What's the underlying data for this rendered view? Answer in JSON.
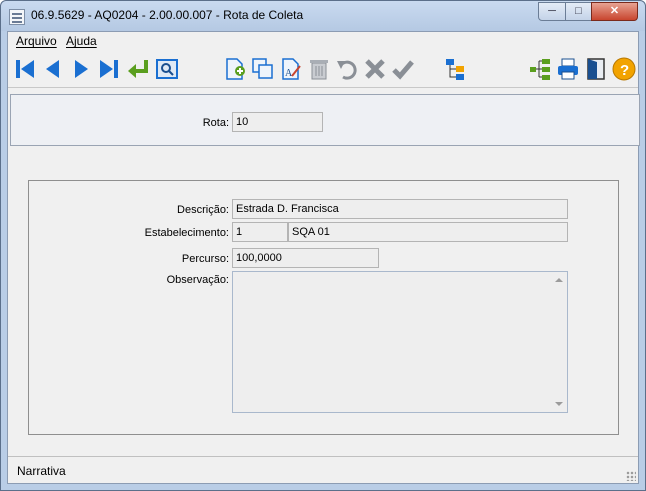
{
  "window": {
    "title": "06.9.5629 - AQ0204 - 2.00.00.007 - Rota de Coleta"
  },
  "menu": [
    {
      "label": "Arquivo"
    },
    {
      "label": "Ajuda"
    }
  ],
  "toolbar": {
    "icons": [
      "first-record-icon",
      "previous-record-icon",
      "next-record-icon",
      "last-record-icon",
      "goto-icon",
      "search-icon",
      "new-record-icon",
      "copy-record-icon",
      "edit-record-icon",
      "delete-record-icon",
      "undo-icon",
      "cancel-icon",
      "confirm-icon",
      "tree-structure-icon",
      "hierarchy-icon",
      "print-icon",
      "exit-icon",
      "help-icon"
    ]
  },
  "form": {
    "rota_label": "Rota:",
    "rota_value": "10",
    "descricao_label": "Descrição:",
    "descricao_value": "Estrada D. Francisca",
    "estabelecimento_label": "Estabelecimento:",
    "estabelecimento_code": "1",
    "estabelecimento_name": "SQA 01",
    "percurso_label": "Percurso:",
    "percurso_value": "100,0000",
    "observacao_label": "Observação:",
    "observacao_value": ""
  },
  "status": {
    "text": "Narrativa"
  },
  "colors": {
    "title_bar": "#b9cde6",
    "toolbar_blue": "#1a6fd1",
    "toolbar_green": "#5a9e1e",
    "help_orange": "#f2a300",
    "close_red": "#c8452e"
  }
}
